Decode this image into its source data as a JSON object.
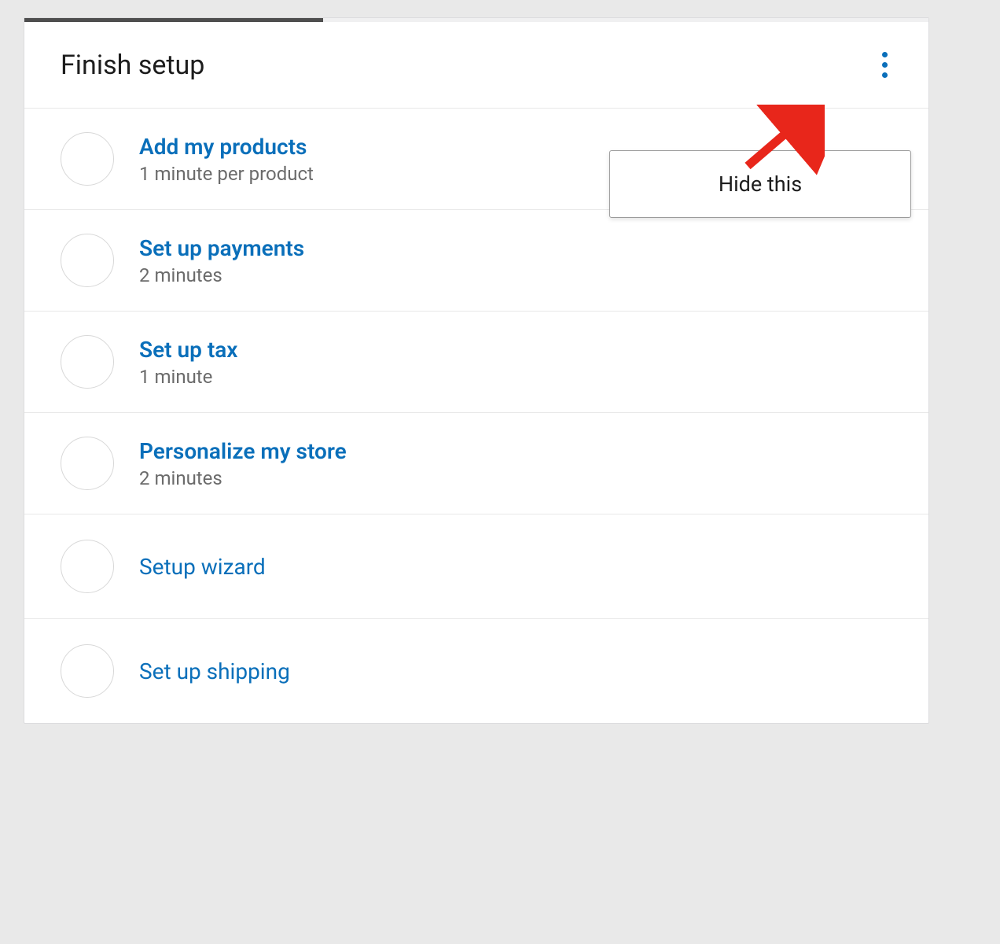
{
  "header": {
    "title": "Finish setup"
  },
  "dropdown": {
    "hide_label": "Hide this"
  },
  "tasks": [
    {
      "title": "Add my products",
      "time": "1 minute per product"
    },
    {
      "title": "Set up payments",
      "time": "2 minutes"
    },
    {
      "title": "Set up tax",
      "time": "1 minute"
    },
    {
      "title": "Personalize my store",
      "time": "2 minutes"
    },
    {
      "title": "Setup wizard",
      "time": ""
    },
    {
      "title": "Set up shipping",
      "time": ""
    }
  ]
}
